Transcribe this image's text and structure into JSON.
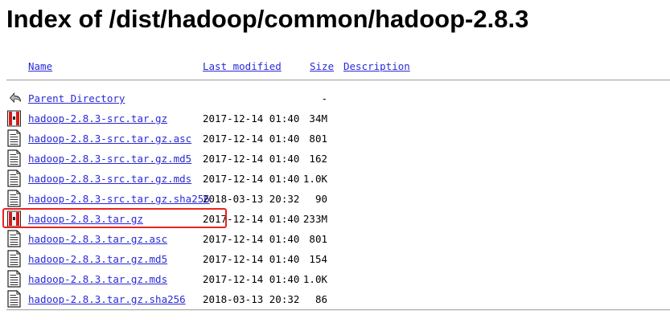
{
  "page": {
    "title": "Index of /dist/hadoop/common/hadoop-2.8.3"
  },
  "headers": {
    "name": "Name",
    "last_modified": "Last modified",
    "size": "Size",
    "description": "Description"
  },
  "rows": [
    {
      "icon": "back-icon",
      "name": "Parent Directory",
      "date": "",
      "size": "-"
    },
    {
      "icon": "archive-icon",
      "name": "hadoop-2.8.3-src.tar.gz",
      "date": "2017-12-14 01:40",
      "size": "34M"
    },
    {
      "icon": "text-file-icon",
      "name": "hadoop-2.8.3-src.tar.gz.asc",
      "date": "2017-12-14 01:40",
      "size": "801"
    },
    {
      "icon": "text-file-icon",
      "name": "hadoop-2.8.3-src.tar.gz.md5",
      "date": "2017-12-14 01:40",
      "size": "162"
    },
    {
      "icon": "text-file-icon",
      "name": "hadoop-2.8.3-src.tar.gz.mds",
      "date": "2017-12-14 01:40",
      "size": "1.0K"
    },
    {
      "icon": "text-file-icon",
      "name": "hadoop-2.8.3-src.tar.gz.sha256",
      "date": "2018-03-13 20:32",
      "size": "90"
    },
    {
      "icon": "archive-icon",
      "name": "hadoop-2.8.3.tar.gz",
      "date": "2017-12-14 01:40",
      "size": "233M",
      "highlighted": true
    },
    {
      "icon": "text-file-icon",
      "name": "hadoop-2.8.3.tar.gz.asc",
      "date": "2017-12-14 01:40",
      "size": "801"
    },
    {
      "icon": "text-file-icon",
      "name": "hadoop-2.8.3.tar.gz.md5",
      "date": "2017-12-14 01:40",
      "size": "154"
    },
    {
      "icon": "text-file-icon",
      "name": "hadoop-2.8.3.tar.gz.mds",
      "date": "2017-12-14 01:40",
      "size": "1.0K"
    },
    {
      "icon": "text-file-icon",
      "name": "hadoop-2.8.3.tar.gz.sha256",
      "date": "2018-03-13 20:32",
      "size": "86"
    }
  ],
  "colors": {
    "link": "#2a2ad8",
    "highlight": "#e8231f"
  }
}
